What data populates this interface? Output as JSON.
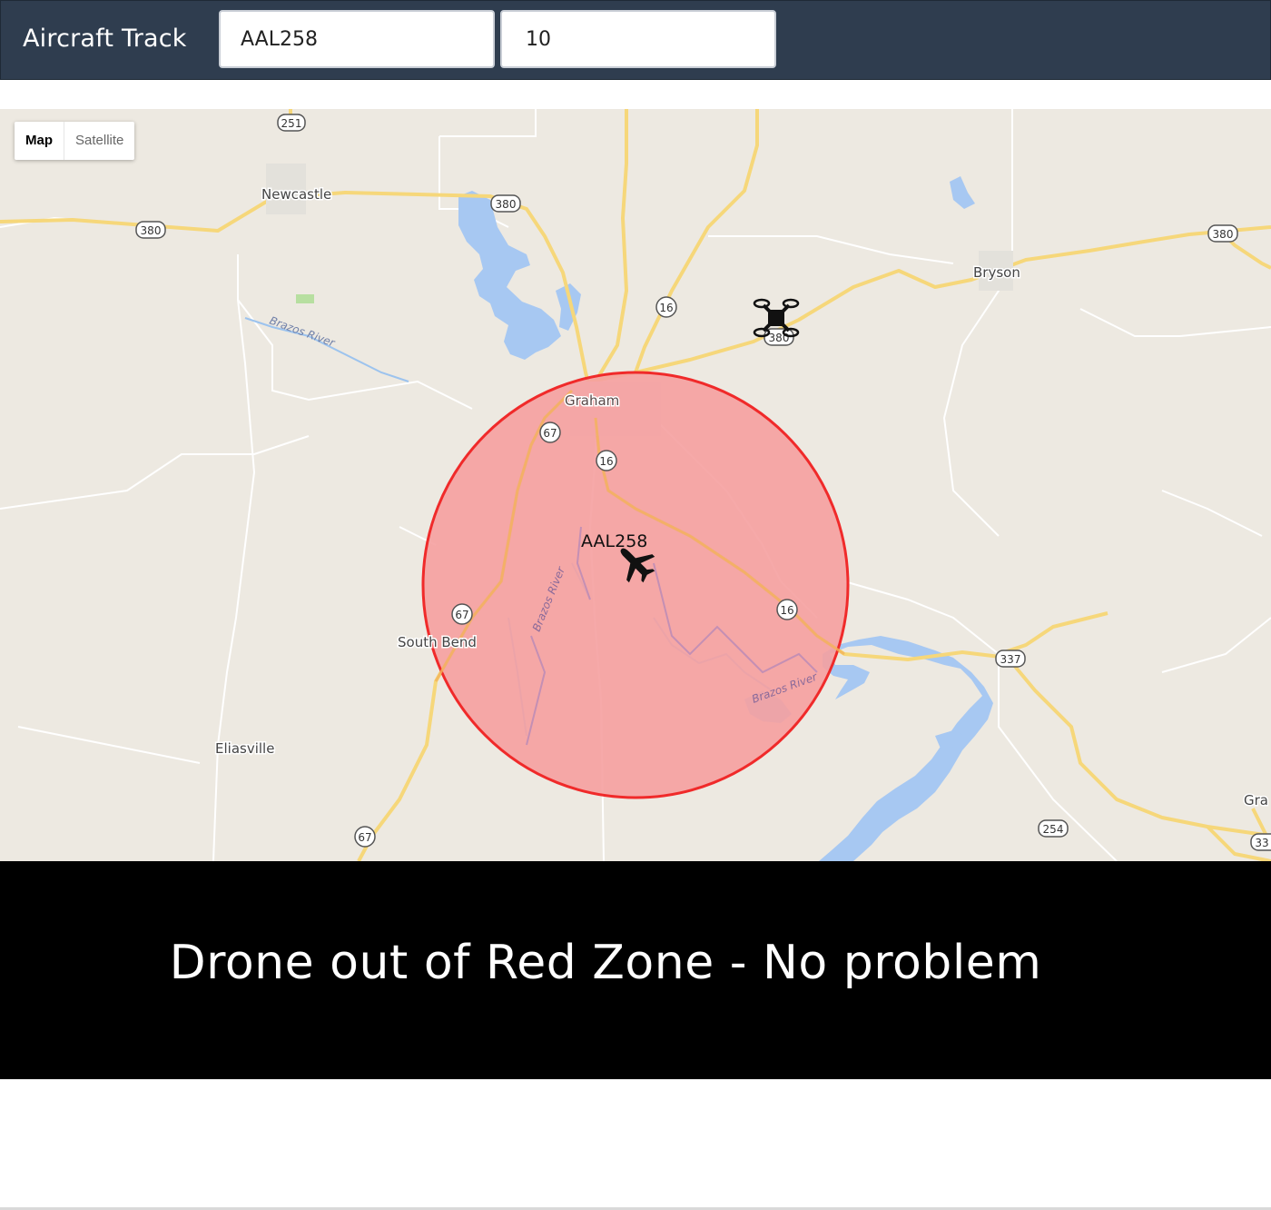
{
  "navbar": {
    "brand": "Aircraft Track",
    "flight_input": "AAL258",
    "radius_input": "10"
  },
  "map": {
    "map_type": {
      "map": "Map",
      "satellite": "Satellite"
    },
    "places": {
      "newcastle": "Newcastle",
      "bryson": "Bryson",
      "graham": "Graham",
      "south_bend": "South Bend",
      "eliasville": "Eliasville",
      "gra": "Gra"
    },
    "rivers": {
      "brazos_1": "Brazos River",
      "brazos_2": "Brazos River",
      "brazos_3": "Brazos River"
    },
    "shields": {
      "hwy251": "251",
      "hwy380_a": "380",
      "hwy380_b": "380",
      "hwy380_c": "380",
      "hwy380_d": "380",
      "hwy16_a": "16",
      "hwy16_b": "16",
      "hwy16_c": "16",
      "hwy67_a": "67",
      "hwy67_b": "67",
      "hwy67_c": "67",
      "hwy337": "337",
      "hwy254": "254",
      "hwy33x": "33"
    },
    "aircraft_label": "AAL258",
    "zone_color": "#f03030",
    "zone_fill": "#f59a9a"
  },
  "status": {
    "message": "Drone out of Red Zone - No problem"
  }
}
